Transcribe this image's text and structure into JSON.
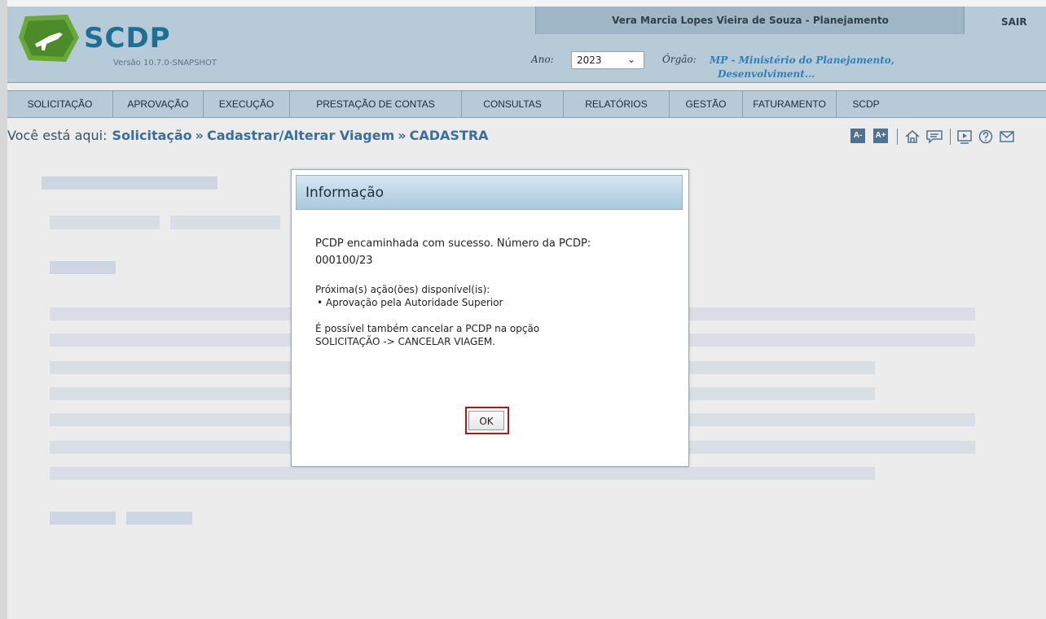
{
  "app": {
    "brand": "SCDP",
    "version": "Versão 10.7.0-SNAPSHOT"
  },
  "header": {
    "user": "Vera Marcia Lopes Vieira de Souza - Planejamento",
    "logout": "SAIR",
    "ano_label": "Ano:",
    "ano_value": "2023",
    "orgao_label": "Órgão:",
    "orgao_line1": "MP - Ministério do Planejamento,",
    "orgao_line2": "Desenvolviment..."
  },
  "nav": {
    "items": [
      "SOLICITAÇÃO",
      "APROVAÇÃO",
      "EXECUÇÃO",
      "PRESTAÇÃO DE CONTAS",
      "CONSULTAS",
      "RELATÓRIOS",
      "GESTÃO",
      "FATURAMENTO",
      "SCDP"
    ]
  },
  "breadcrumb": {
    "label": "Você está aqui:",
    "items": [
      "Solicitação",
      "Cadastrar/Alterar Viagem",
      "CADASTRA"
    ],
    "separator": "»"
  },
  "tools": {
    "font_decrease": "A-",
    "font_increase": "A+",
    "icons": [
      "home-icon",
      "chat-icon",
      "video-icon",
      "help-icon",
      "mail-icon"
    ]
  },
  "dialog": {
    "title": "Informação",
    "message_line1": "PCDP encaminhada com sucesso. Número da PCDP:",
    "message_line2": "000100/23",
    "actions_heading": "Próxima(s) ação(ões) disponível(is):",
    "actions": [
      "Aprovação pela Autoridade Superior"
    ],
    "note_line1": "É possível também cancelar a PCDP na opção",
    "note_line2": "SOLICITAÇÃO -> CANCELAR VIAGEM.",
    "ok_label": "OK"
  },
  "colors": {
    "header_bg": "#b6cad7",
    "accent_link": "#3b6f99",
    "highlight_border": "#b01818"
  }
}
